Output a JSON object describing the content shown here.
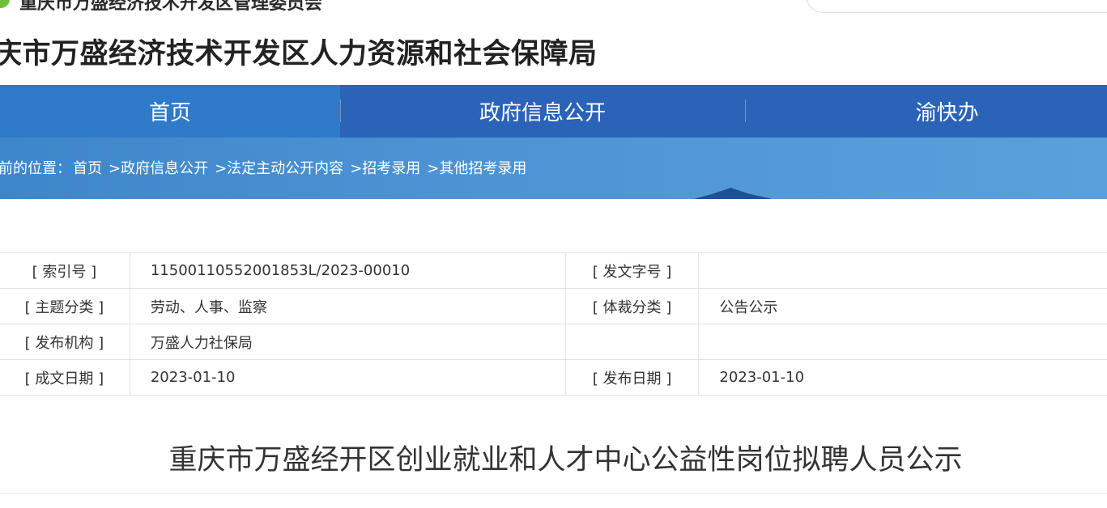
{
  "header": {
    "top_text_partial": "重庆市万盛经济技术开发区管理委员会",
    "site_title": "庆市万盛经济技术开发区人力资源和社会保障局"
  },
  "nav": {
    "items": [
      {
        "label": "首页"
      },
      {
        "label": "政府信息公开"
      },
      {
        "label": "渝快办"
      }
    ]
  },
  "breadcrumb": {
    "prefix": "前的位置：",
    "items": [
      "首页",
      ">政府信息公开",
      ">法定主动公开内容",
      ">招考录用",
      ">其他招考录用"
    ]
  },
  "meta": {
    "rows": [
      {
        "l1": "[ 索引号 ]",
        "v1": "11500110552001853L/2023-00010",
        "l2": "[ 发文字号 ]",
        "v2": ""
      },
      {
        "l1": "[ 主题分类 ]",
        "v1": "劳动、人事、监察",
        "l2": "[ 体裁分类 ]",
        "v2": "公告公示"
      },
      {
        "l1": "[ 发布机构 ]",
        "v1": "万盛人力社保局",
        "l2": "",
        "v2": ""
      },
      {
        "l1": "[ 成文日期 ]",
        "v1": "2023-01-10",
        "l2": "[ 发布日期 ]",
        "v2": "2023-01-10"
      }
    ]
  },
  "document": {
    "title": "重庆市万盛经开区创业就业和人才中心公益性岗位拟聘人员公示"
  },
  "colors": {
    "nav_bg": "#2a63b7",
    "nav_active_bg": "#2f7bc9",
    "banner_bg": "#4d93d4",
    "logo_green": "#6fbf3b"
  }
}
